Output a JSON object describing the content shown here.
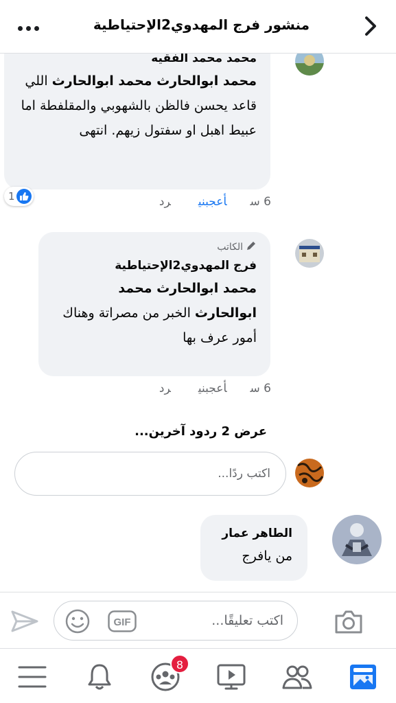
{
  "header": {
    "title": "منشور فرج المهدوي2الإحتياطية"
  },
  "comments": [
    {
      "name": "محمد محمد الفقيه",
      "body_bold": "محمد ابوالحارث محمد ابوالحارث",
      "body_text": "اللي قاعد يحسن فالظن بالشهوبي والمقلفطة اما عبيط اهبل او سفتول زيهم. انتهى",
      "time": "6 س",
      "like_label": "أعجبني",
      "reply_label": "رد",
      "reaction_count": "1"
    },
    {
      "author_tag": "الكاتب",
      "name": "فرج المهدوي2الإحتياطية",
      "body_bold": "محمد ابوالحارث محمد ابوالحارث",
      "body_text": "الخبر من مصراتة وهناك أمور عرف بها",
      "time": "6 س",
      "like_label": "أعجبني",
      "reply_label": "رد"
    },
    {
      "name": "الطاهر عمار",
      "body_text": "من يافرج"
    }
  ],
  "more_replies": "عرض 2 ردود آخرين...",
  "reply_placeholder": "اكتب ردًا...",
  "composer": {
    "placeholder": "اكتب تعليقًا...",
    "gif_label": "GIF"
  },
  "tabbar": {
    "groups_badge": "8"
  },
  "colors": {
    "accent": "#1877f2",
    "bubble": "#f0f2f5",
    "badge": "#e41e3f"
  }
}
